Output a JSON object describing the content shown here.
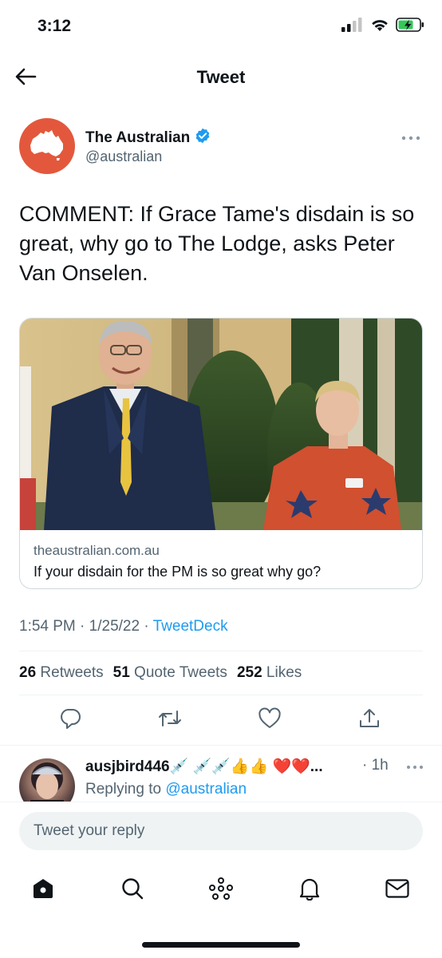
{
  "status_bar": {
    "time": "3:12",
    "icons": [
      "cellular-signal-icon",
      "wifi-icon",
      "battery-charging-icon"
    ]
  },
  "nav": {
    "title": "Tweet",
    "back_icon": "arrow-left-icon"
  },
  "tweet": {
    "author_name": "The Australian",
    "author_handle": "@australian",
    "verified": true,
    "text": "COMMENT: If Grace Tame's disdain is so great, why go to The Lodge, asks Peter Van Onselen.",
    "card": {
      "domain": "theaustralian.com.au",
      "title": "If your disdain for the PM is so great why go?"
    },
    "time": "1:54 PM",
    "date": "1/25/22",
    "source": "TweetDeck",
    "stats": {
      "retweets_count": "26",
      "retweets_label": "Retweets",
      "quote_tweets_count": "51",
      "quote_tweets_label": "Quote Tweets",
      "likes_count": "252",
      "likes_label": "Likes"
    }
  },
  "reply": {
    "username": "ausjbird446",
    "emoji_suffix": "💉 💉💉👍👍 ❤️❤️...",
    "age": "1h",
    "replying_to_label": "Replying to",
    "replying_to_handle": "@australian"
  },
  "composer": {
    "placeholder": "Tweet your reply"
  },
  "tabbar": {
    "items": [
      "home-icon",
      "search-icon",
      "spaces-icon",
      "notifications-icon",
      "messages-icon"
    ]
  },
  "colors": {
    "accent": "#1d9bf0",
    "secondary_text": "#536471",
    "primary_text": "#0f1419",
    "avatar_brand": "#e3583c"
  }
}
